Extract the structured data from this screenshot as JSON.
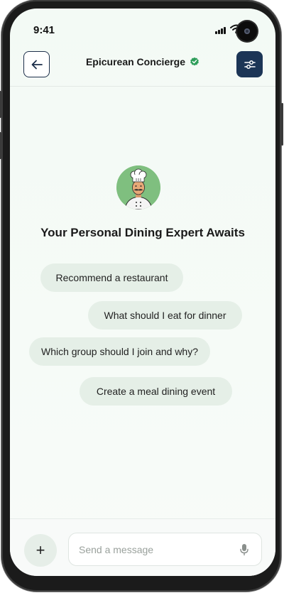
{
  "status_bar": {
    "time": "9:41"
  },
  "header": {
    "title": "Epicurean Concierge"
  },
  "hero": {
    "heading": "Your Personal Dining Expert Awaits"
  },
  "suggestions": [
    {
      "label": "Recommend a restaurant"
    },
    {
      "label": "What should I eat for dinner"
    },
    {
      "label": "Which group should I join and why?"
    },
    {
      "label": "Create a meal dining event"
    }
  ],
  "composer": {
    "placeholder": "Send a message",
    "add_label": "+"
  },
  "icons": {
    "back": "arrow-left-icon",
    "verified": "verified-badge-icon",
    "filter": "sliders-icon",
    "mic": "microphone-icon",
    "plus": "plus-icon",
    "avatar": "chef-avatar"
  },
  "colors": {
    "accent_dark": "#1c3556",
    "verified_green": "#2f9e5b",
    "chip_bg": "#e5efe7",
    "avatar_bg": "#7fbf7f"
  }
}
